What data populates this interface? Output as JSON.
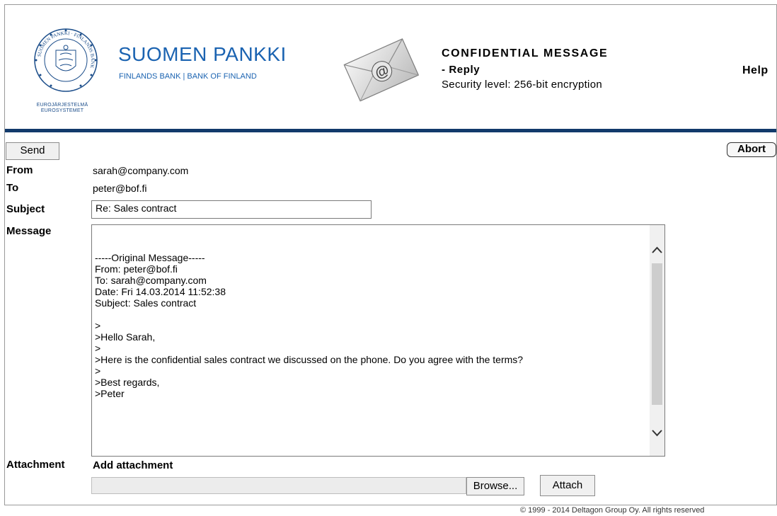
{
  "header": {
    "seal_caption_line1": "EUROJÄRJESTELMÄ",
    "seal_caption_line2": "EUROSYSTEMET",
    "seal_ring_text": "SUOMEN PANKKI · FINLANDS BANK",
    "brand_title": "SUOMEN PANKKI",
    "brand_subtitle": "FINLANDS BANK | BANK OF FINLAND",
    "confidential_title": "CONFIDENTIAL MESSAGE",
    "reply_label": "- Reply",
    "security_text": "Security level: 256-bit encryption",
    "help_label": "Help",
    "brand_color": "#1b63b1",
    "rule_color": "#123a6b"
  },
  "toolbar": {
    "send_label": "Send",
    "abort_label": "Abort"
  },
  "form": {
    "from_label": "From",
    "from_value": "sarah@company.com",
    "to_label": "To",
    "to_value": "peter@bof.fi",
    "subject_label": "Subject",
    "subject_value": "Re: Sales contract",
    "message_label": "Message",
    "message_body": "-----Original Message-----\nFrom: peter@bof.fi\nTo: sarah@company.com\nDate: Fri 14.03.2014 11:52:38\nSubject: Sales contract\n\n>\n>Hello Sarah,\n>\n>Here is the confidential sales contract we discussed on the phone. Do you agree with the terms?\n>\n>Best regards,\n>Peter",
    "attachment_label": "Attachment",
    "add_attachment_label": "Add attachment",
    "browse_label": "Browse...",
    "attach_label": "Attach"
  },
  "footer": {
    "copyright": "© 1999 - 2014 Deltagon Group Oy. All rights reserved"
  }
}
